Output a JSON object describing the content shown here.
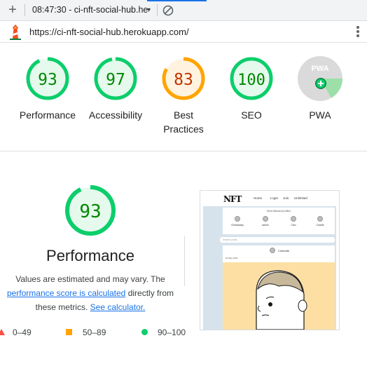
{
  "toolbar": {
    "new_tab_symbol": "+",
    "report_label": "08:47:30 - ci-nft-social-hub.he",
    "dropdown_symbol": "▾",
    "block_icon": "block-icon"
  },
  "urlbar": {
    "url": "https://ci-nft-social-hub.herokuapp.com/",
    "logo_icon": "lighthouse-icon",
    "menu_icon": "kebab-menu-icon"
  },
  "categories": [
    {
      "label": "Performance",
      "score": "93",
      "rating": "pass"
    },
    {
      "label": "Accessibility",
      "score": "97",
      "rating": "pass"
    },
    {
      "label": "Best Practices",
      "score": "83",
      "rating": "average"
    },
    {
      "label": "SEO",
      "score": "100",
      "rating": "pass"
    },
    {
      "label": "PWA",
      "badge_text": "PWA",
      "rating": "pwa"
    }
  ],
  "performance": {
    "score": "93",
    "title": "Performance",
    "desc_1": "Values are estimated and may vary. The",
    "link_1": "performance score is calculated",
    "desc_2": "directly from these metrics.",
    "link_2": "See calculator."
  },
  "legend": {
    "fail": "0–49",
    "average": "50–89",
    "pass": "90–100"
  },
  "colors": {
    "pass": "#0cce6b",
    "pass_text": "#008800",
    "average": "#ffa400",
    "average_text": "#c33300",
    "fail": "#ff4e42",
    "link": "#1a73e8"
  },
  "thumbnail": {
    "logo": "NFT",
    "nav": [
      "Home",
      "Login",
      "Join",
      "Unlimited"
    ],
    "card_title": "Most followed profiles",
    "profiles": [
      "Chrisblacky",
      "admin",
      "Cleo",
      "Charlie"
    ],
    "search_placeholder": "Search posts",
    "post_author": "Charlotte",
    "post_date": "04 May 2023"
  }
}
